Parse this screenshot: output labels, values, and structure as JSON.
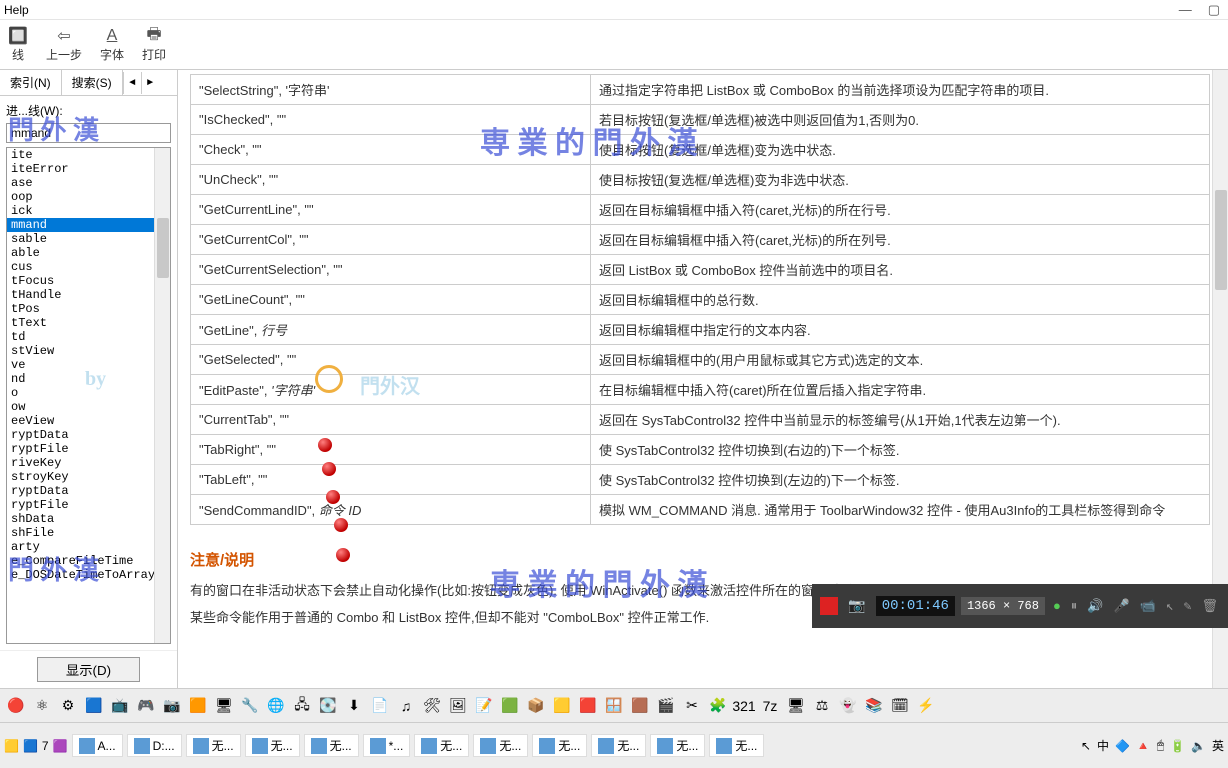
{
  "window": {
    "title": "Help"
  },
  "toolbar": {
    "home": "线",
    "back": "上一步",
    "font": "字体",
    "print": "打印"
  },
  "tabs": {
    "index": "索引(N)",
    "search": "搜索(S)",
    "prev": "◄",
    "next": "►"
  },
  "kw": {
    "label": "进...线(W):",
    "value": "mmand"
  },
  "list": {
    "items": [
      "ite",
      "iteError",
      "",
      "ase",
      "oop",
      "ick",
      "mmand",
      "sable",
      "able",
      "cus",
      "tFocus",
      "tHandle",
      "tPos",
      "tText",
      "td",
      "stView",
      "ve",
      "",
      "nd",
      "o",
      "ow",
      "eeView",
      "",
      "ryptData",
      "ryptFile",
      "riveKey",
      "stroyKey",
      "ryptData",
      "ryptFile",
      "shData",
      "shFile",
      "arty",
      "e_CompareFileTime",
      "e_DOSDateTimeToArray"
    ],
    "selected_index": 6
  },
  "show_btn": "显示(D)",
  "rows": [
    {
      "cmd": "\"SelectString\", '字符串'",
      "desc": "通过指定字符串把 ListBox 或 ComboBox 的当前选择项设为匹配字符串的项目."
    },
    {
      "cmd": "\"IsChecked\", \"\"",
      "desc": "若目标按钮(复选框/单选框)被选中则返回值为1,否则为0."
    },
    {
      "cmd": "\"Check\", \"\"",
      "desc": "使目标按钮(复选框/单选框)变为选中状态."
    },
    {
      "cmd": "\"UnCheck\", \"\"",
      "desc": "使目标按钮(复选框/单选框)变为非选中状态."
    },
    {
      "cmd": "\"GetCurrentLine\", \"\"",
      "desc": "返回在目标编辑框中插入符(caret,光标)的所在行号."
    },
    {
      "cmd": "\"GetCurrentCol\", \"\"",
      "desc": "返回在目标编辑框中插入符(caret,光标)的所在列号."
    },
    {
      "cmd": "\"GetCurrentSelection\", \"\"",
      "desc": "返回 ListBox 或 ComboBox 控件当前选中的项目名."
    },
    {
      "cmd": "\"GetLineCount\", \"\"",
      "desc": "返回目标编辑框中的总行数."
    },
    {
      "cmd_pre": "\"GetLine\", ",
      "cmd_it": "行号",
      "desc": "返回目标编辑框中指定行的文本内容."
    },
    {
      "cmd": "\"GetSelected\", \"\"",
      "desc": "返回目标编辑框中的(用户用鼠标或其它方式)选定的文本."
    },
    {
      "cmd_pre": "\"EditPaste\", ",
      "cmd_it": "'字符串'",
      "desc": "在目标编辑框中插入符(caret)所在位置后插入指定字符串."
    },
    {
      "cmd": "\"CurrentTab\", \"\"",
      "desc": "返回在 SysTabControl32 控件中当前显示的标签编号(从1开始,1代表左边第一个)."
    },
    {
      "cmd": "\"TabRight\", \"\"",
      "desc": "使 SysTabControl32 控件切换到(右边的)下一个标签."
    },
    {
      "cmd": "\"TabLeft\", \"\"",
      "desc": "使 SysTabControl32 控件切换到(左边的)下一个标签."
    },
    {
      "cmd_pre": "\"SendCommandID\", ",
      "cmd_it": "命令 ID",
      "desc": "模拟 WM_COMMAND 消息. 通常用于 ToolbarWindow32 控件 - 使用Au3Info的工具栏标签得到命令"
    }
  ],
  "section": {
    "heading": "注意/说明",
    "p1": "有的窗口在非活动状态下会禁止自动化操作(比如:按钮变成灰色). 使用 WinActivate() 函数来激活控件所在的窗口过后再使...",
    "p2": "某些命令能作用于普通的 Combo 和 ListBox 控件,但却不能对 \"ComboLBox\" 控件正常工作."
  },
  "rec": {
    "time": "00:01:46",
    "dim": "1366 × 768"
  },
  "task": {
    "items": [
      {
        "label": "A..."
      },
      {
        "label": "D:..."
      },
      {
        "label": "无..."
      },
      {
        "label": "无..."
      },
      {
        "label": "无..."
      },
      {
        "label": "*..."
      },
      {
        "label": "无..."
      },
      {
        "label": "无..."
      },
      {
        "label": "无..."
      },
      {
        "label": "无..."
      },
      {
        "label": "无..."
      },
      {
        "label": "无..."
      }
    ],
    "lang": "英",
    "ime": "中"
  },
  "wm": {
    "top": "専 業 的 門 外 漢",
    "byline": "by",
    "bottom": "専 業 的 門 外 漢",
    "faint": "門外汉",
    "left": "門 外 漢"
  }
}
